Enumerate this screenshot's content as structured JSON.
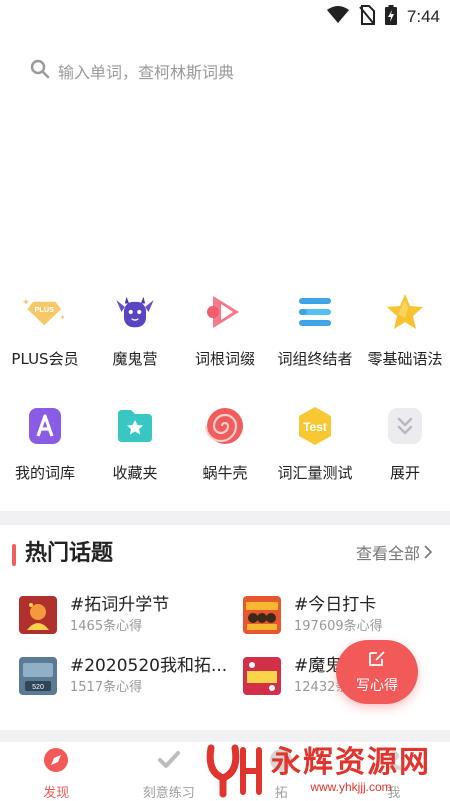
{
  "status_bar": {
    "time": "7:44"
  },
  "search": {
    "placeholder": "输入单词，查柯林斯词典"
  },
  "grid_row1": [
    {
      "label": "PLUS会员",
      "icon": "plus-badge-icon"
    },
    {
      "label": "魔鬼营",
      "icon": "devil-mascot-icon"
    },
    {
      "label": "词根词缀",
      "icon": "play-triangle-icon"
    },
    {
      "label": "词组终结者",
      "icon": "lines-icon"
    },
    {
      "label": "零基础语法",
      "icon": "star-icon"
    }
  ],
  "grid_row2": [
    {
      "label": "我的词库",
      "icon": "letter-a-icon"
    },
    {
      "label": "收藏夹",
      "icon": "folder-star-icon"
    },
    {
      "label": "蜗牛壳",
      "icon": "snail-shell-icon"
    },
    {
      "label": "词汇量测试",
      "icon": "test-badge-icon"
    },
    {
      "label": "展开",
      "icon": "chevron-double-down-icon"
    }
  ],
  "plus_badge_text": "PLUS",
  "test_badge_text": "Test",
  "hot_topics": {
    "title": "热门话题",
    "more": "查看全部",
    "items": [
      {
        "title": "#拓词升学节",
        "count": "1465条心得"
      },
      {
        "title": "#今日打卡",
        "count": "197609条心得"
      },
      {
        "title": "#2020520我和拓...",
        "count": "1517条心得"
      },
      {
        "title": "#魔鬼",
        "count": "12432条"
      }
    ]
  },
  "fab": {
    "label": "写心得"
  },
  "tabbar": {
    "tabs": [
      {
        "label": "发现",
        "icon": "compass-icon",
        "active": true
      },
      {
        "label": "刻意练习",
        "icon": "check-icon",
        "active": false
      },
      {
        "label": "拓",
        "icon": "tab3-icon",
        "active": false
      },
      {
        "label": "我",
        "icon": "tab4-icon",
        "active": false
      }
    ]
  },
  "watermark": {
    "main": "永辉资源网",
    "sub": "www.yhkjjj.com"
  },
  "colors": {
    "accent": "#f25a5a",
    "divider": "#f1f1f3",
    "text_secondary": "#999999"
  }
}
